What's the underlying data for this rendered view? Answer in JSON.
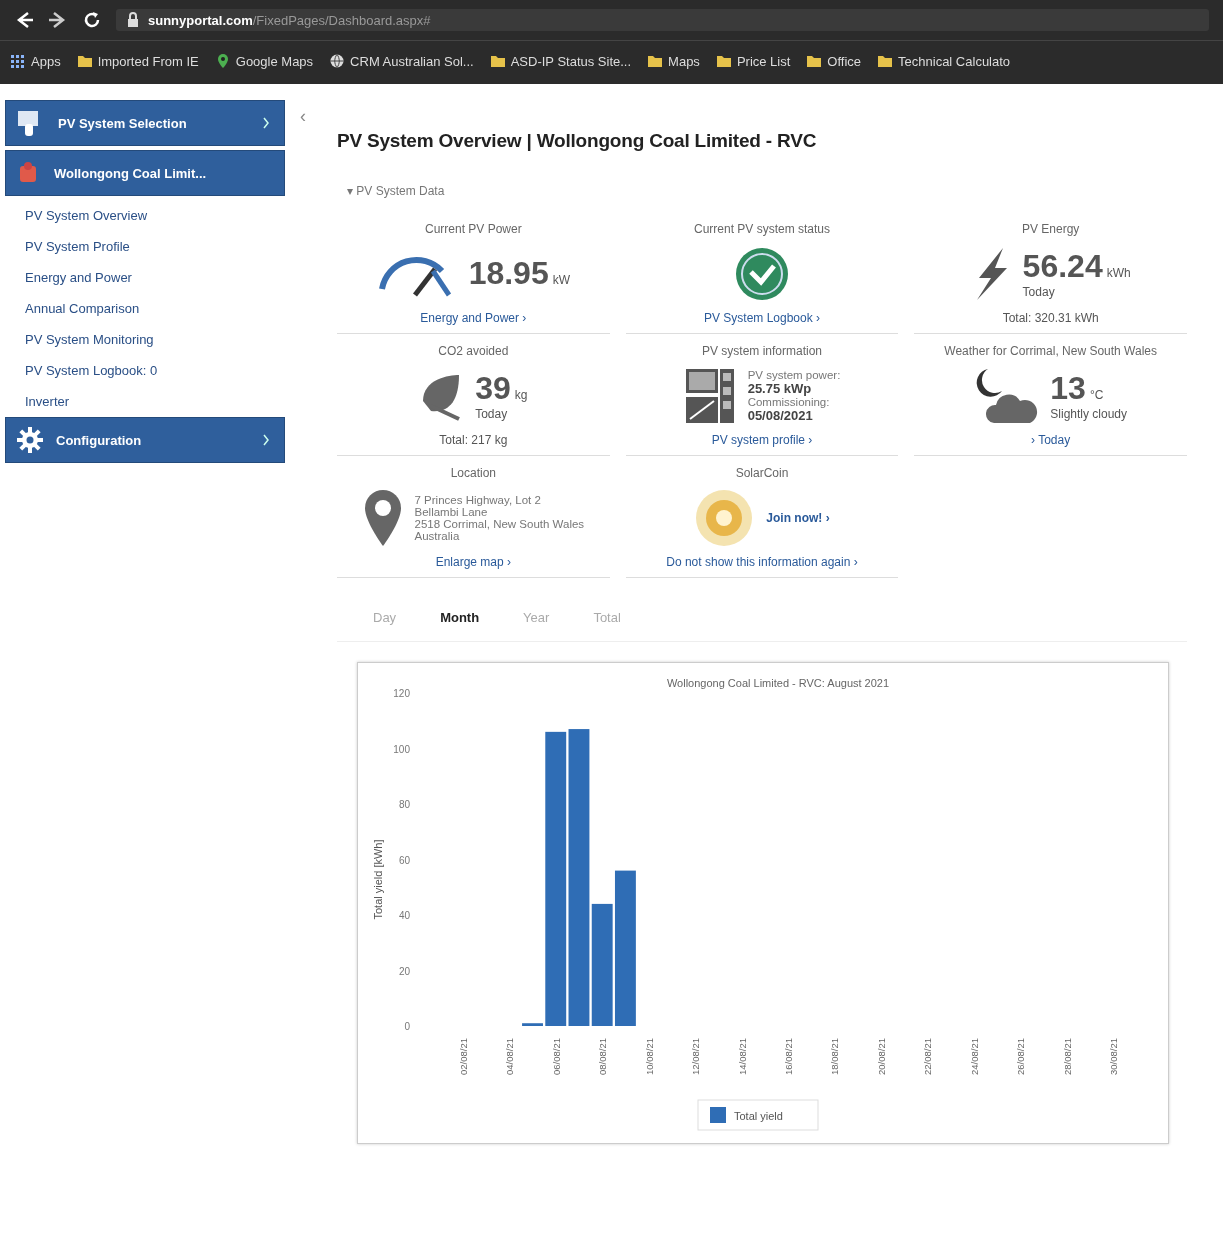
{
  "browser": {
    "url_host": "sunnyportal.com",
    "url_path": "/FixedPages/Dashboard.aspx#",
    "bookmarks": [
      {
        "label": "Apps",
        "kind": "apps"
      },
      {
        "label": "Imported From IE",
        "kind": "folder"
      },
      {
        "label": "Google Maps",
        "kind": "maps"
      },
      {
        "label": "CRM Australian Sol...",
        "kind": "globe"
      },
      {
        "label": "ASD-IP Status Site...",
        "kind": "folder"
      },
      {
        "label": "Maps",
        "kind": "folder"
      },
      {
        "label": "Price List",
        "kind": "folder"
      },
      {
        "label": "Office",
        "kind": "folder"
      },
      {
        "label": "Technical Calculato",
        "kind": "folder"
      }
    ]
  },
  "sidebar": {
    "system_selection": "PV System Selection",
    "plant": "Wollongong Coal Limit...",
    "items": [
      "PV System Overview",
      "PV System Profile",
      "Energy and Power",
      "Annual Comparison",
      "PV System Monitoring",
      "PV System Logbook: 0",
      "Inverter"
    ],
    "configuration": "Configuration",
    "collapse": "‹"
  },
  "page_title": "PV System Overview | Wollongong Coal Limited - RVC",
  "section_toggle": "▾ PV System Data",
  "cards": [
    {
      "kind": "power",
      "title": "Current PV Power",
      "value": "18.95",
      "unit": "kW",
      "link": "Energy and Power ›"
    },
    {
      "kind": "status",
      "title": "Current PV system status",
      "link": "PV System Logbook ›"
    },
    {
      "kind": "energy",
      "title": "PV Energy",
      "value": "56.24",
      "unit": "kWh",
      "sub": "Today",
      "footer": "Total: 320.31 kWh"
    },
    {
      "kind": "co2",
      "title": "CO2 avoided",
      "value": "39",
      "unit": "kg",
      "sub": "Today",
      "footer": "Total: 217 kg"
    },
    {
      "kind": "info",
      "title": "PV system information",
      "lines": [
        "PV system power:",
        "25.75 kWp",
        "Commissioning:",
        "05/08/2021"
      ],
      "link": "PV system profile ›"
    },
    {
      "kind": "weather",
      "title": "Weather for Corrimal, New South Wales",
      "value": "13",
      "unit": "°C",
      "sub": "Slightly cloudy",
      "link": "› Today"
    },
    {
      "kind": "location",
      "title": "Location",
      "lines": [
        "7 Princes Highway, Lot 2",
        "Bellambi Lane",
        "2518 Corrimal, New South Wales",
        "Australia"
      ],
      "link": "Enlarge map ›"
    },
    {
      "kind": "solarcoin",
      "title": "SolarCoin",
      "action": "Join now! ›",
      "link": "Do not show this information again ›"
    }
  ],
  "period_tabs": [
    {
      "label": "Day",
      "selected": false
    },
    {
      "label": "Month",
      "selected": true
    },
    {
      "label": "Year",
      "selected": false
    },
    {
      "label": "Total",
      "selected": false
    }
  ],
  "chart": {
    "chart_data": {
      "type": "bar",
      "title": "Wollongong Coal Limited - RVC: August 2021",
      "ylabel": "Total yield [kWh]",
      "categories": [
        null,
        "02/08/21",
        null,
        "04/08/21",
        null,
        "06/08/21",
        null,
        "08/08/21",
        null,
        "10/08/21",
        null,
        "12/08/21",
        null,
        "14/08/21",
        null,
        "16/08/21",
        null,
        "18/08/21",
        null,
        "20/08/21",
        null,
        "22/08/21",
        null,
        "24/08/21",
        null,
        "26/08/21",
        null,
        "28/08/21",
        null,
        "30/08/21",
        null
      ],
      "series": [
        {
          "name": "Total yield",
          "color": "#2f6db5",
          "values": [
            null,
            null,
            null,
            null,
            1,
            106,
            107,
            44,
            56,
            null,
            null,
            null,
            null,
            null,
            null,
            null,
            null,
            null,
            null,
            null,
            null,
            null,
            null,
            null,
            null,
            null,
            null,
            null,
            null,
            null,
            null
          ]
        }
      ],
      "ylim": [
        0,
        120
      ],
      "yticks": [
        0,
        20,
        40,
        60,
        80,
        100,
        120
      ]
    }
  }
}
